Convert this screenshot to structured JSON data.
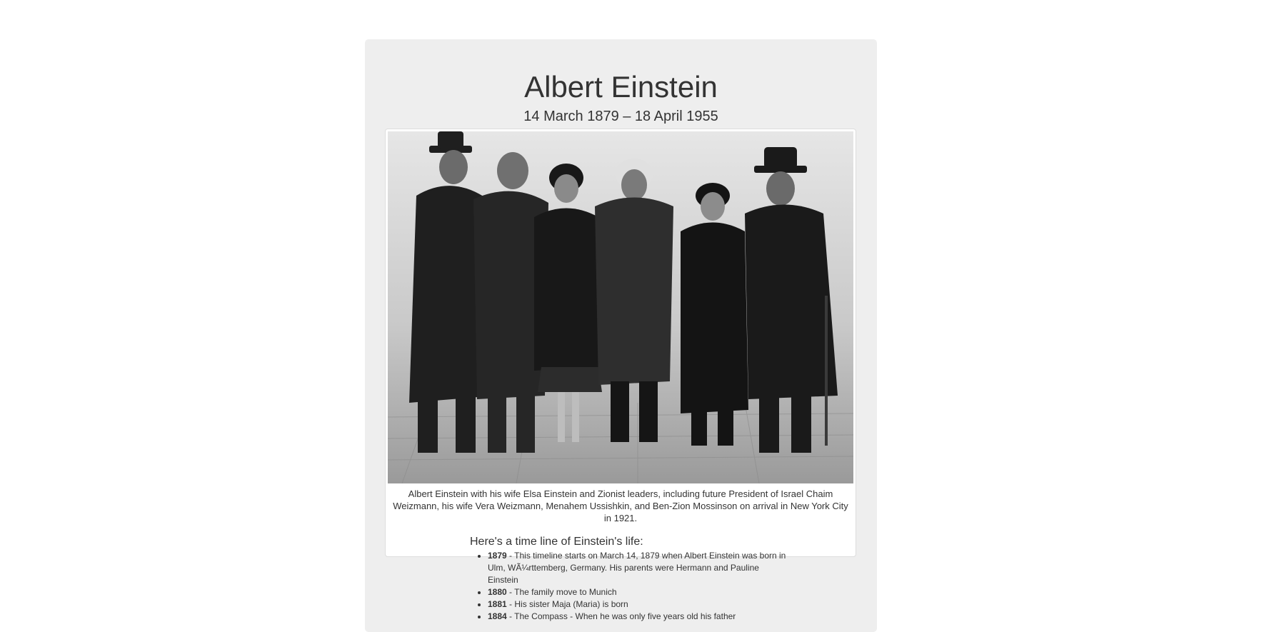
{
  "header": {
    "title": "Albert Einstein",
    "subtitle": "14 March 1879 – 18 April 1955"
  },
  "figure": {
    "caption": "Albert Einstein with his wife Elsa Einstein and Zionist leaders, including future President of Israel Chaim Weizmann, his wife Vera Weizmann, Menahem Ussishkin, and Ben-Zion Mossinson on arrival in New York City in 1921."
  },
  "timeline": {
    "heading": "Here's a time line of Einstein's life:",
    "items": [
      {
        "year": "1879",
        "text": " - This timeline starts on March 14, 1879 when Albert Einstein was born in Ulm, WÃ¼rttemberg, Germany. His parents were Hermann and Pauline Einstein"
      },
      {
        "year": "1880",
        "text": " - The family move to Munich"
      },
      {
        "year": "1881",
        "text": " - His sister Maja (Maria) is born"
      },
      {
        "year": "1884",
        "text": " - The Compass - When he was only five years old his father"
      }
    ]
  },
  "colors": {
    "page_background": "#ffffff",
    "panel_background": "#eeeeee",
    "text": "#333333"
  }
}
